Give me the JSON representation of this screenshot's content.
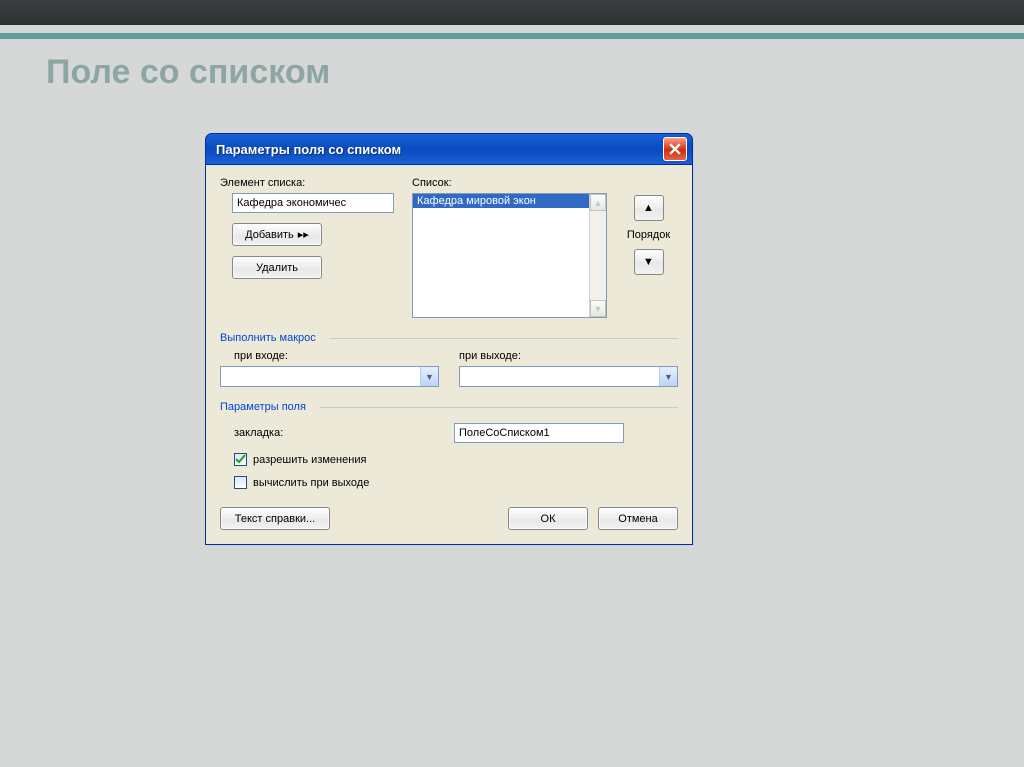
{
  "page": {
    "title": "Поле со списком"
  },
  "dialog": {
    "title": "Параметры поля со списком",
    "labels": {
      "list_item": "Элемент списка:",
      "list": "Список:",
      "order": "Порядок"
    },
    "inputs": {
      "list_item_value": "Кафедра экономичес"
    },
    "buttons": {
      "add": "Добавить",
      "delete": "Удалить",
      "help_text": "Текст справки...",
      "ok": "ОК",
      "cancel": "Отмена"
    },
    "list_items": [
      "Кафедра мировой экон"
    ],
    "groups": {
      "macro": "Выполнить макрос",
      "field_params": "Параметры поля"
    },
    "macro": {
      "on_enter": "при входе:",
      "on_exit": "при выходе:"
    },
    "field": {
      "bookmark_label": "закладка:",
      "bookmark_value": "ПолеСоСписком1",
      "allow_changes": "разрешить изменения",
      "calc_on_exit": "вычислить при выходе"
    }
  }
}
